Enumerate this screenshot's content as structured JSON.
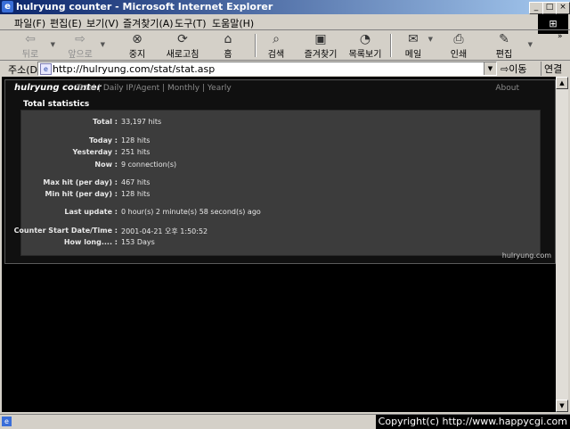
{
  "window": {
    "title": "hulryung counter - Microsoft Internet Explorer",
    "minimize": "_",
    "maximize": "□",
    "close": "×"
  },
  "menubar": {
    "items": [
      "파일(F)",
      "편집(E)",
      "보기(V)",
      "즐겨찾기(A)",
      "도구(T)",
      "도움말(H)"
    ]
  },
  "toolbar": {
    "buttons": [
      {
        "label": "뒤로",
        "icon": "back-icon",
        "disabled": true
      },
      {
        "label": "앞으로",
        "icon": "forward-icon",
        "disabled": true
      },
      {
        "label": "중지",
        "icon": "stop-icon",
        "disabled": false
      },
      {
        "label": "새로고침",
        "icon": "refresh-icon",
        "disabled": false
      },
      {
        "label": "홈",
        "icon": "home-icon",
        "disabled": false
      },
      {
        "label": "검색",
        "icon": "search-icon",
        "disabled": false
      },
      {
        "label": "즐겨찾기",
        "icon": "favorites-icon",
        "disabled": false
      },
      {
        "label": "목록보기",
        "icon": "history-icon",
        "disabled": false
      },
      {
        "label": "메일",
        "icon": "mail-icon",
        "disabled": false
      },
      {
        "label": "인쇄",
        "icon": "print-icon",
        "disabled": false
      },
      {
        "label": "편집",
        "icon": "edit-icon",
        "disabled": false
      }
    ]
  },
  "address": {
    "label": "주소(D)",
    "url": "http://hulryung.com/stat/stat.asp",
    "go": "이동",
    "links": "연결"
  },
  "page": {
    "brand": "hulryung counter",
    "nav": [
      "Total",
      "Daily IP/Agent",
      "Monthly",
      "Yearly"
    ],
    "about": "About",
    "section_title": "Total statistics",
    "stats": [
      {
        "key": "Total :",
        "value": "33,197 hits"
      },
      {
        "key": "Today :",
        "value": "128 hits"
      },
      {
        "key": "Yesterday :",
        "value": "251 hits"
      },
      {
        "key": "Now :",
        "value": "9 connection(s)"
      },
      {
        "key": "Max hit (per day) :",
        "value": "467 hits"
      },
      {
        "key": "Min hit (per day) :",
        "value": "128 hits"
      },
      {
        "key": "Last update :",
        "value": "0 hour(s) 2 minute(s) 58 second(s) ago"
      },
      {
        "key": "Counter Start Date/Time :",
        "value": "2001-04-21 오후 1:50:52"
      },
      {
        "key": "How long.... :",
        "value": "153 Days"
      }
    ],
    "footer": "hulryung.com"
  },
  "statusbar": {
    "copyright": "Copyright(c) http://www.happycgi.com"
  }
}
